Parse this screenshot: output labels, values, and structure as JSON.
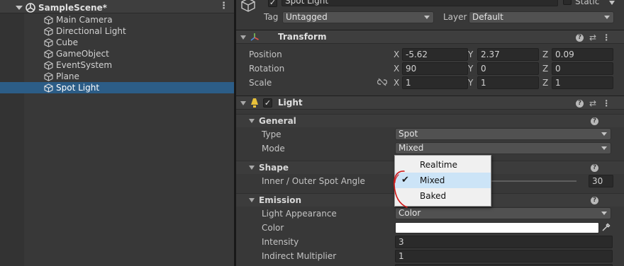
{
  "hierarchy": {
    "scene": "SampleScene*",
    "items": [
      {
        "label": "Main Camera"
      },
      {
        "label": "Directional Light"
      },
      {
        "label": "Cube"
      },
      {
        "label": "GameObject"
      },
      {
        "label": "EventSystem"
      },
      {
        "label": "Plane"
      },
      {
        "label": "Spot Light"
      }
    ],
    "selected_index": 6
  },
  "inspector": {
    "object_name": "Spot Light",
    "static_label": "Static",
    "tag_label": "Tag",
    "tag_value": "Untagged",
    "layer_label": "Layer",
    "layer_value": "Default",
    "transform": {
      "title": "Transform",
      "position": {
        "label": "Position",
        "x": "-5.62",
        "y": "2.37",
        "z": "0.09"
      },
      "rotation": {
        "label": "Rotation",
        "x": "90",
        "y": "0",
        "z": "0"
      },
      "scale": {
        "label": "Scale",
        "x": "1",
        "y": "1",
        "z": "1"
      },
      "axis_x": "X",
      "axis_y": "Y",
      "axis_z": "Z"
    },
    "light": {
      "title": "Light",
      "general": {
        "title": "General",
        "type_label": "Type",
        "type_value": "Spot",
        "mode_label": "Mode",
        "mode_value": "Mixed"
      },
      "shape": {
        "title": "Shape",
        "angle_label": "Inner / Outer Spot Angle",
        "angle_value": "30"
      },
      "emission": {
        "title": "Emission",
        "appearance_label": "Light Appearance",
        "appearance_value": "Color",
        "color_label": "Color",
        "color_value": "#ffffff",
        "intensity_label": "Intensity",
        "intensity_value": "3",
        "indirect_label": "Indirect Multiplier",
        "indirect_value": "1"
      }
    }
  },
  "mode_popup": {
    "options": [
      "Realtime",
      "Mixed",
      "Baked"
    ],
    "checked": "Mixed"
  },
  "colors": {
    "selection": "#2c5d87",
    "annotation": "#d11b1b",
    "popup_highlight": "#cce4f7"
  }
}
